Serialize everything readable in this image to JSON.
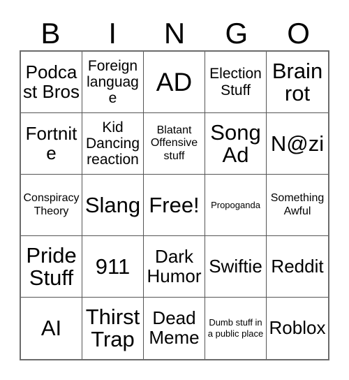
{
  "card": {
    "header_letters": [
      "B",
      "I",
      "N",
      "G",
      "O"
    ],
    "rows": [
      [
        {
          "label": "Podcast Bros",
          "size": "l"
        },
        {
          "label": "Foreign language",
          "size": "m"
        },
        {
          "label": "AD",
          "size": "xxl"
        },
        {
          "label": "Election Stuff",
          "size": "m"
        },
        {
          "label": "Brain rot",
          "size": "xl"
        }
      ],
      [
        {
          "label": "Fortnite",
          "size": "l"
        },
        {
          "label": "Kid Dancing reaction",
          "size": "m"
        },
        {
          "label": "Blatant Offensive stuff",
          "size": "s"
        },
        {
          "label": "Song Ad",
          "size": "xl"
        },
        {
          "label": "N@zi",
          "size": "xl"
        }
      ],
      [
        {
          "label": "Conspiracy Theory",
          "size": "s"
        },
        {
          "label": "Slang",
          "size": "xl"
        },
        {
          "label": "Free!",
          "size": "xl"
        },
        {
          "label": "Propoganda",
          "size": "xs"
        },
        {
          "label": "Something Awful",
          "size": "s"
        }
      ],
      [
        {
          "label": "Pride Stuff",
          "size": "xl"
        },
        {
          "label": "911",
          "size": "xl"
        },
        {
          "label": "Dark Humor",
          "size": "l"
        },
        {
          "label": "Swiftie",
          "size": "l"
        },
        {
          "label": "Reddit",
          "size": "l"
        }
      ],
      [
        {
          "label": "AI",
          "size": "xl"
        },
        {
          "label": "Thirst Trap",
          "size": "xl"
        },
        {
          "label": "Dead Meme",
          "size": "l"
        },
        {
          "label": "Dumb stuff in a public place",
          "size": "xs"
        },
        {
          "label": "Roblox",
          "size": "l"
        }
      ]
    ],
    "colors": {
      "background": "#ffffff",
      "text": "#000000",
      "grid_line": "#555555",
      "grid_outer": "#6b6b6b"
    }
  }
}
